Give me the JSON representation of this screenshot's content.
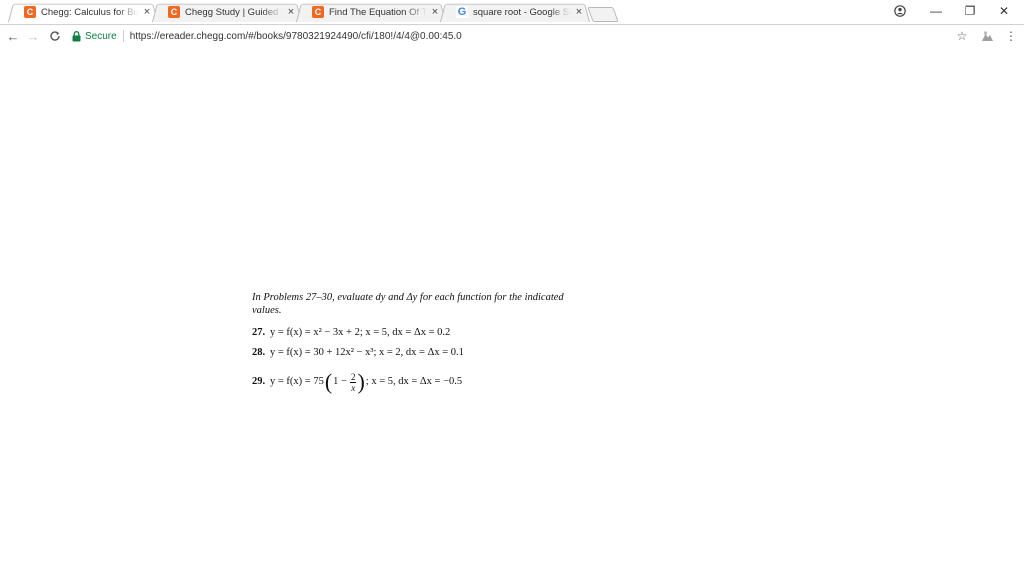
{
  "tabs": [
    {
      "title": "Chegg: Calculus for Business, Economics, Life Sciences and Social Sciences",
      "favicon": "C",
      "close": "×",
      "active": true
    },
    {
      "title": "Chegg Study | Guided Solutions",
      "favicon": "C",
      "close": "×",
      "active": false
    },
    {
      "title": "Find The Equation Of The",
      "favicon": "C",
      "close": "×",
      "active": false
    },
    {
      "title": "square root - Google Search",
      "favicon": "G",
      "close": "×",
      "active": false
    }
  ],
  "window": {
    "account_icon": "account-circle-icon",
    "minimize": "—",
    "restore": "❐",
    "close": "✕"
  },
  "toolbar": {
    "back": "←",
    "forward": "→",
    "reload": "C",
    "secure_label": "Secure",
    "url": "https://ereader.chegg.com/#/books/9780321924490/cfi/180!/4/4@0.00:45.0",
    "star": "☆",
    "menu": "⋮"
  },
  "textbook": {
    "intro": "In Problems 27–30, evaluate dy and Δy for each function for the indicated values.",
    "problems": [
      {
        "number": "27.",
        "expression": "y = f(x) = x² − 3x + 2; x = 5, dx = Δx = 0.2"
      },
      {
        "number": "28.",
        "expression": "y = f(x) = 30 + 12x² − x³; x = 2, dx = Δx = 0.1"
      },
      {
        "number": "29.",
        "expression_prefix": "y = f(x) = 75",
        "frac_num": "2",
        "frac_den": "x",
        "expression_suffix": "; x = 5, dx = Δx = −0.5",
        "one_minus": "1 −"
      }
    ]
  },
  "colors": {
    "accent_orange": "#f26722",
    "secure_green": "#0b8043"
  }
}
